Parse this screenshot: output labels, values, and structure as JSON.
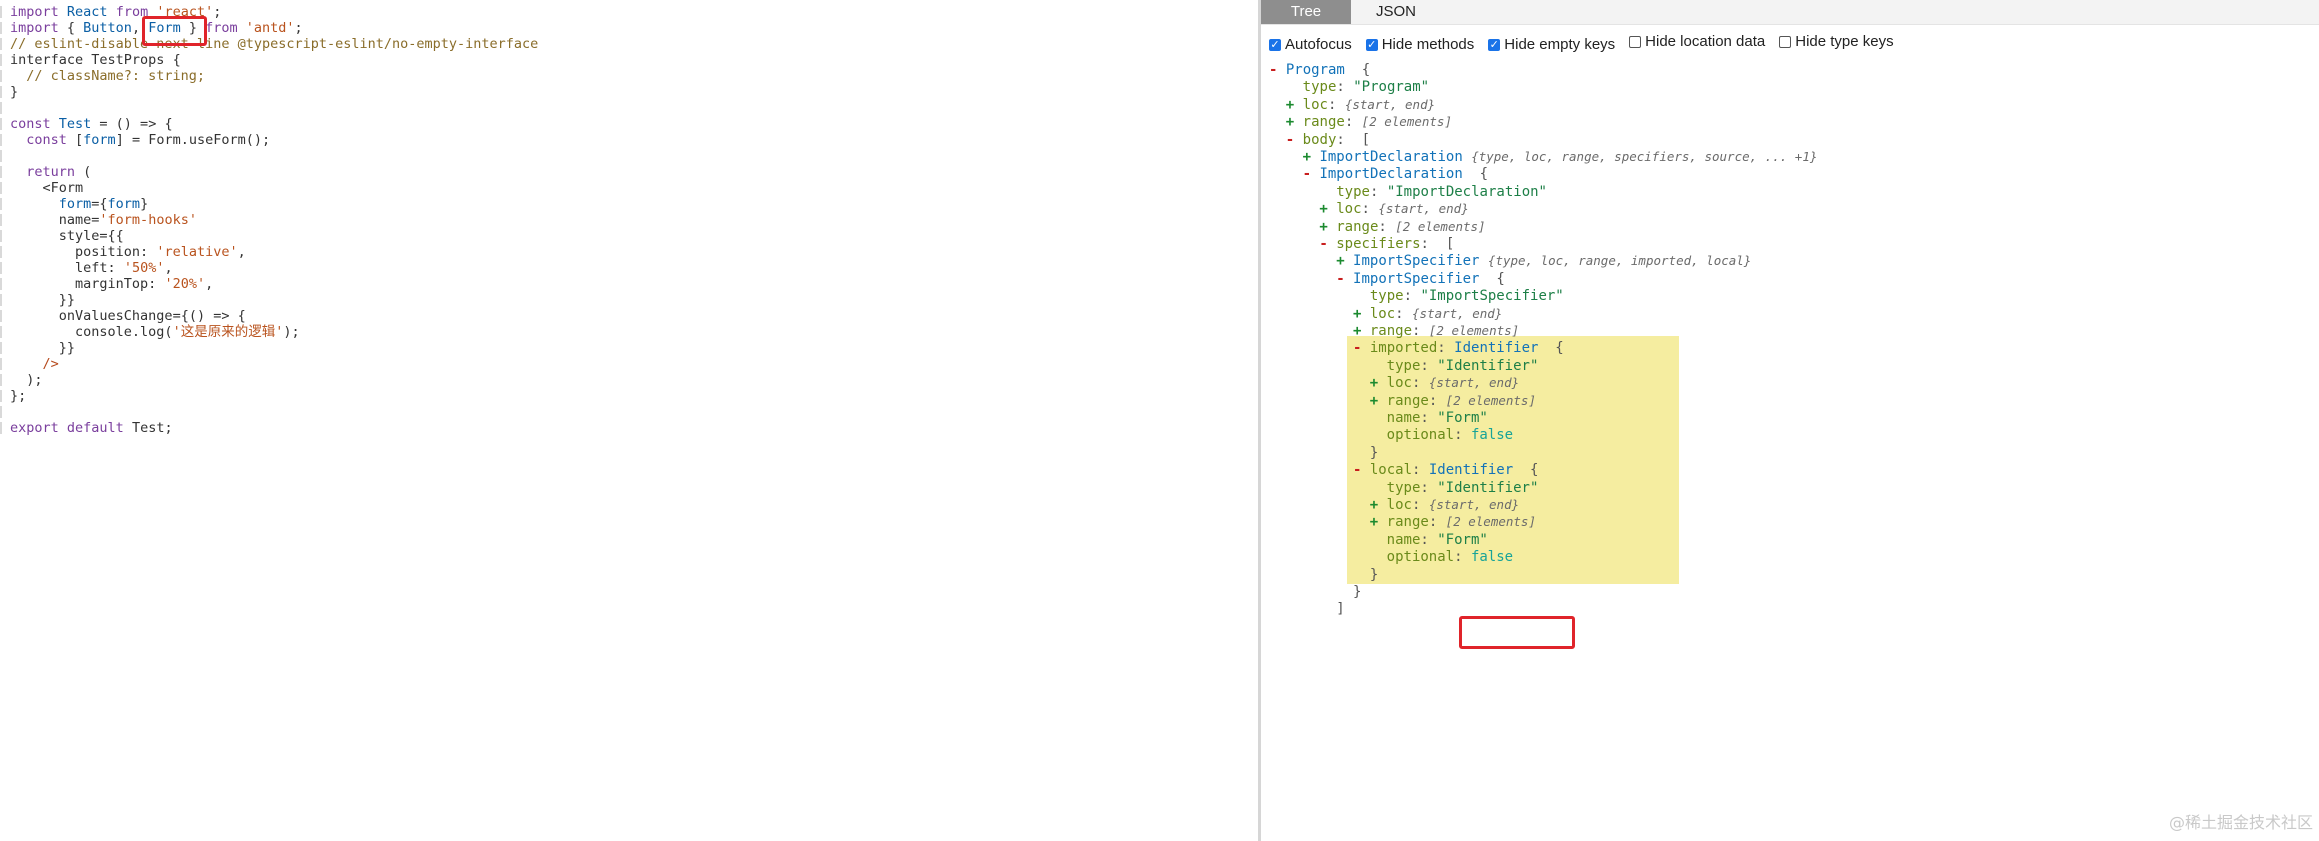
{
  "editor": {
    "lines": [
      [
        [
          "import ",
          "kw"
        ],
        [
          "React ",
          "type"
        ],
        [
          "from ",
          "kw"
        ],
        [
          "'react'",
          "str"
        ],
        [
          ";",
          "punct"
        ]
      ],
      [
        [
          "import ",
          "kw"
        ],
        [
          "{ ",
          "punct"
        ],
        [
          "Button",
          "type"
        ],
        [
          ", ",
          "punct"
        ],
        [
          "Form",
          "type"
        ],
        [
          " } ",
          "punct"
        ],
        [
          "from ",
          "kw"
        ],
        [
          "'antd'",
          "str"
        ],
        [
          ";",
          "punct"
        ]
      ],
      [
        [
          "// eslint-disable-next-line @typescript-eslint/no-empty-interface",
          "comment"
        ]
      ],
      [
        [
          "interface ",
          "punct"
        ],
        [
          "TestProps ",
          "punct"
        ],
        [
          "{",
          "punct"
        ]
      ],
      [
        [
          "  // className?: string;",
          "comment"
        ]
      ],
      [
        [
          "}",
          "punct"
        ]
      ],
      [
        [
          "",
          "punct"
        ]
      ],
      [
        [
          "const ",
          "kw"
        ],
        [
          "Test ",
          "type"
        ],
        [
          "= () => {",
          "punct"
        ]
      ],
      [
        [
          "  const ",
          "kw"
        ],
        [
          "[",
          "punct"
        ],
        [
          "form",
          "var"
        ],
        [
          "] = Form.useForm();",
          "punct"
        ]
      ],
      [
        [
          "",
          "punct"
        ]
      ],
      [
        [
          "  return ",
          "kw"
        ],
        [
          "(",
          "punct"
        ]
      ],
      [
        [
          "    <Form",
          "punct"
        ]
      ],
      [
        [
          "      form",
          "var"
        ],
        [
          "={",
          "punct"
        ],
        [
          "form",
          "var"
        ],
        [
          "}",
          "punct"
        ]
      ],
      [
        [
          "      name",
          "punct"
        ],
        [
          "=",
          "punct"
        ],
        [
          "'form-hooks'",
          "str"
        ]
      ],
      [
        [
          "      style",
          "punct"
        ],
        [
          "={{",
          "punct"
        ]
      ],
      [
        [
          "        position",
          "punct"
        ],
        [
          ": ",
          "punct"
        ],
        [
          "'relative'",
          "str"
        ],
        [
          ",",
          "punct"
        ]
      ],
      [
        [
          "        left",
          "punct"
        ],
        [
          ": ",
          "punct"
        ],
        [
          "'50%'",
          "str"
        ],
        [
          ",",
          "punct"
        ]
      ],
      [
        [
          "        marginTop",
          "punct"
        ],
        [
          ": ",
          "punct"
        ],
        [
          "'20%'",
          "str"
        ],
        [
          ",",
          "punct"
        ]
      ],
      [
        [
          "      }}",
          "punct"
        ]
      ],
      [
        [
          "      onValuesChange",
          "punct"
        ],
        [
          "={() => {",
          "punct"
        ]
      ],
      [
        [
          "        console.log(",
          "punct"
        ],
        [
          "'这是原来的逻辑'",
          "str"
        ],
        [
          ");",
          "punct"
        ]
      ],
      [
        [
          "      }}",
          "punct"
        ]
      ],
      [
        [
          "    />",
          "tag"
        ]
      ],
      [
        [
          "  );",
          "punct"
        ]
      ],
      [
        [
          "};",
          "punct"
        ]
      ],
      [
        [
          "",
          "punct"
        ]
      ],
      [
        [
          "export ",
          "kw"
        ],
        [
          "default ",
          "kw"
        ],
        [
          "Test;",
          "punct"
        ]
      ]
    ]
  },
  "ast_panel": {
    "tabs": [
      {
        "label": "Tree",
        "active": true
      },
      {
        "label": "JSON",
        "active": false
      }
    ],
    "options": [
      {
        "label": "Autofocus",
        "checked": true
      },
      {
        "label": "Hide methods",
        "checked": true
      },
      {
        "label": "Hide empty keys",
        "checked": true
      },
      {
        "label": "Hide location data",
        "checked": false
      },
      {
        "label": "Hide type keys",
        "checked": false
      }
    ],
    "tree": [
      {
        "depth": 0,
        "toggle": "-",
        "segs": [
          [
            "Program",
            "node"
          ],
          [
            "  {",
            "brace"
          ]
        ]
      },
      {
        "depth": 1,
        "toggle": "",
        "segs": [
          [
            "type",
            "prop"
          ],
          [
            ": ",
            "brace"
          ],
          [
            "\"Program\"",
            "str"
          ]
        ]
      },
      {
        "depth": 1,
        "toggle": "+",
        "segs": [
          [
            "loc",
            "prop"
          ],
          [
            ": ",
            "brace"
          ],
          [
            "{start, end}",
            "summary"
          ]
        ]
      },
      {
        "depth": 1,
        "toggle": "+",
        "segs": [
          [
            "range",
            "prop"
          ],
          [
            ": ",
            "brace"
          ],
          [
            "[2 elements]",
            "summary"
          ]
        ]
      },
      {
        "depth": 1,
        "toggle": "-",
        "segs": [
          [
            "body",
            "prop"
          ],
          [
            ":  [",
            "brace"
          ]
        ]
      },
      {
        "depth": 2,
        "toggle": "+",
        "segs": [
          [
            "ImportDeclaration",
            "node"
          ],
          [
            " ",
            "brace"
          ],
          [
            "{type, loc, range, specifiers, source, ... +1}",
            "summary"
          ]
        ]
      },
      {
        "depth": 2,
        "toggle": "-",
        "segs": [
          [
            "ImportDeclaration",
            "node"
          ],
          [
            "  {",
            "brace"
          ]
        ]
      },
      {
        "depth": 3,
        "toggle": "",
        "segs": [
          [
            "type",
            "prop"
          ],
          [
            ": ",
            "brace"
          ],
          [
            "\"ImportDeclaration\"",
            "str"
          ]
        ]
      },
      {
        "depth": 3,
        "toggle": "+",
        "segs": [
          [
            "loc",
            "prop"
          ],
          [
            ": ",
            "brace"
          ],
          [
            "{start, end}",
            "summary"
          ]
        ]
      },
      {
        "depth": 3,
        "toggle": "+",
        "segs": [
          [
            "range",
            "prop"
          ],
          [
            ": ",
            "brace"
          ],
          [
            "[2 elements]",
            "summary"
          ]
        ]
      },
      {
        "depth": 3,
        "toggle": "-",
        "segs": [
          [
            "specifiers",
            "prop"
          ],
          [
            ":  [",
            "brace"
          ]
        ]
      },
      {
        "depth": 4,
        "toggle": "+",
        "segs": [
          [
            "ImportSpecifier",
            "node"
          ],
          [
            " ",
            "brace"
          ],
          [
            "{type, loc, range, imported, local}",
            "summary"
          ]
        ]
      },
      {
        "depth": 4,
        "toggle": "-",
        "segs": [
          [
            "ImportSpecifier",
            "node"
          ],
          [
            "  {",
            "brace"
          ]
        ]
      },
      {
        "depth": 5,
        "toggle": "",
        "segs": [
          [
            "type",
            "prop"
          ],
          [
            ": ",
            "brace"
          ],
          [
            "\"ImportSpecifier\"",
            "str"
          ]
        ]
      },
      {
        "depth": 5,
        "toggle": "+",
        "segs": [
          [
            "loc",
            "prop"
          ],
          [
            ": ",
            "brace"
          ],
          [
            "{start, end}",
            "summary"
          ]
        ]
      },
      {
        "depth": 5,
        "toggle": "+",
        "segs": [
          [
            "range",
            "prop"
          ],
          [
            ": ",
            "brace"
          ],
          [
            "[2 elements]",
            "summary"
          ]
        ]
      },
      {
        "depth": 5,
        "toggle": "-",
        "segs": [
          [
            "imported",
            "prop"
          ],
          [
            ": ",
            "brace"
          ],
          [
            "Identifier",
            "node"
          ],
          [
            "  {",
            "brace"
          ]
        ]
      },
      {
        "depth": 6,
        "toggle": "",
        "segs": [
          [
            "type",
            "prop"
          ],
          [
            ": ",
            "brace"
          ],
          [
            "\"Identifier\"",
            "str"
          ]
        ]
      },
      {
        "depth": 6,
        "toggle": "+",
        "segs": [
          [
            "loc",
            "prop"
          ],
          [
            ": ",
            "brace"
          ],
          [
            "{start, end}",
            "summary"
          ]
        ]
      },
      {
        "depth": 6,
        "toggle": "+",
        "segs": [
          [
            "range",
            "prop"
          ],
          [
            ": ",
            "brace"
          ],
          [
            "[2 elements]",
            "summary"
          ]
        ]
      },
      {
        "depth": 6,
        "toggle": "",
        "segs": [
          [
            "name",
            "prop"
          ],
          [
            ": ",
            "brace"
          ],
          [
            "\"Form\"",
            "str"
          ]
        ]
      },
      {
        "depth": 6,
        "toggle": "",
        "segs": [
          [
            "optional",
            "prop"
          ],
          [
            ": ",
            "brace"
          ],
          [
            "false",
            "bool"
          ]
        ]
      },
      {
        "depth": 5,
        "toggle": "",
        "segs": [
          [
            "}",
            "brace"
          ]
        ]
      },
      {
        "depth": 5,
        "toggle": "-",
        "segs": [
          [
            "local",
            "prop"
          ],
          [
            ": ",
            "brace"
          ],
          [
            "Identifier",
            "node"
          ],
          [
            "  {",
            "brace"
          ]
        ]
      },
      {
        "depth": 6,
        "toggle": "",
        "segs": [
          [
            "type",
            "prop"
          ],
          [
            ": ",
            "brace"
          ],
          [
            "\"Identifier\"",
            "str"
          ]
        ]
      },
      {
        "depth": 6,
        "toggle": "+",
        "segs": [
          [
            "loc",
            "prop"
          ],
          [
            ": ",
            "brace"
          ],
          [
            "{start, end}",
            "summary"
          ]
        ]
      },
      {
        "depth": 6,
        "toggle": "+",
        "segs": [
          [
            "range",
            "prop"
          ],
          [
            ": ",
            "brace"
          ],
          [
            "[2 elements]",
            "summary"
          ]
        ]
      },
      {
        "depth": 6,
        "toggle": "",
        "segs": [
          [
            "name",
            "prop"
          ],
          [
            ": ",
            "brace"
          ],
          [
            "\"Form\"",
            "str"
          ]
        ]
      },
      {
        "depth": 6,
        "toggle": "",
        "segs": [
          [
            "optional",
            "prop"
          ],
          [
            ": ",
            "brace"
          ],
          [
            "false",
            "bool"
          ]
        ]
      },
      {
        "depth": 5,
        "toggle": "",
        "segs": [
          [
            "}",
            "brace"
          ]
        ]
      },
      {
        "depth": 4,
        "toggle": "",
        "segs": [
          [
            "}",
            "brace"
          ]
        ]
      },
      {
        "depth": 3,
        "toggle": "",
        "segs": [
          [
            "]",
            "brace"
          ]
        ]
      }
    ]
  },
  "watermark": "@稀土掘金技术社区",
  "colors": {
    "highlight_box": "#e0242a",
    "highlight_bg": "#f5eda0",
    "tab_active_bg": "#8e8e8e",
    "checkbox_checked": "#1a73e8"
  }
}
